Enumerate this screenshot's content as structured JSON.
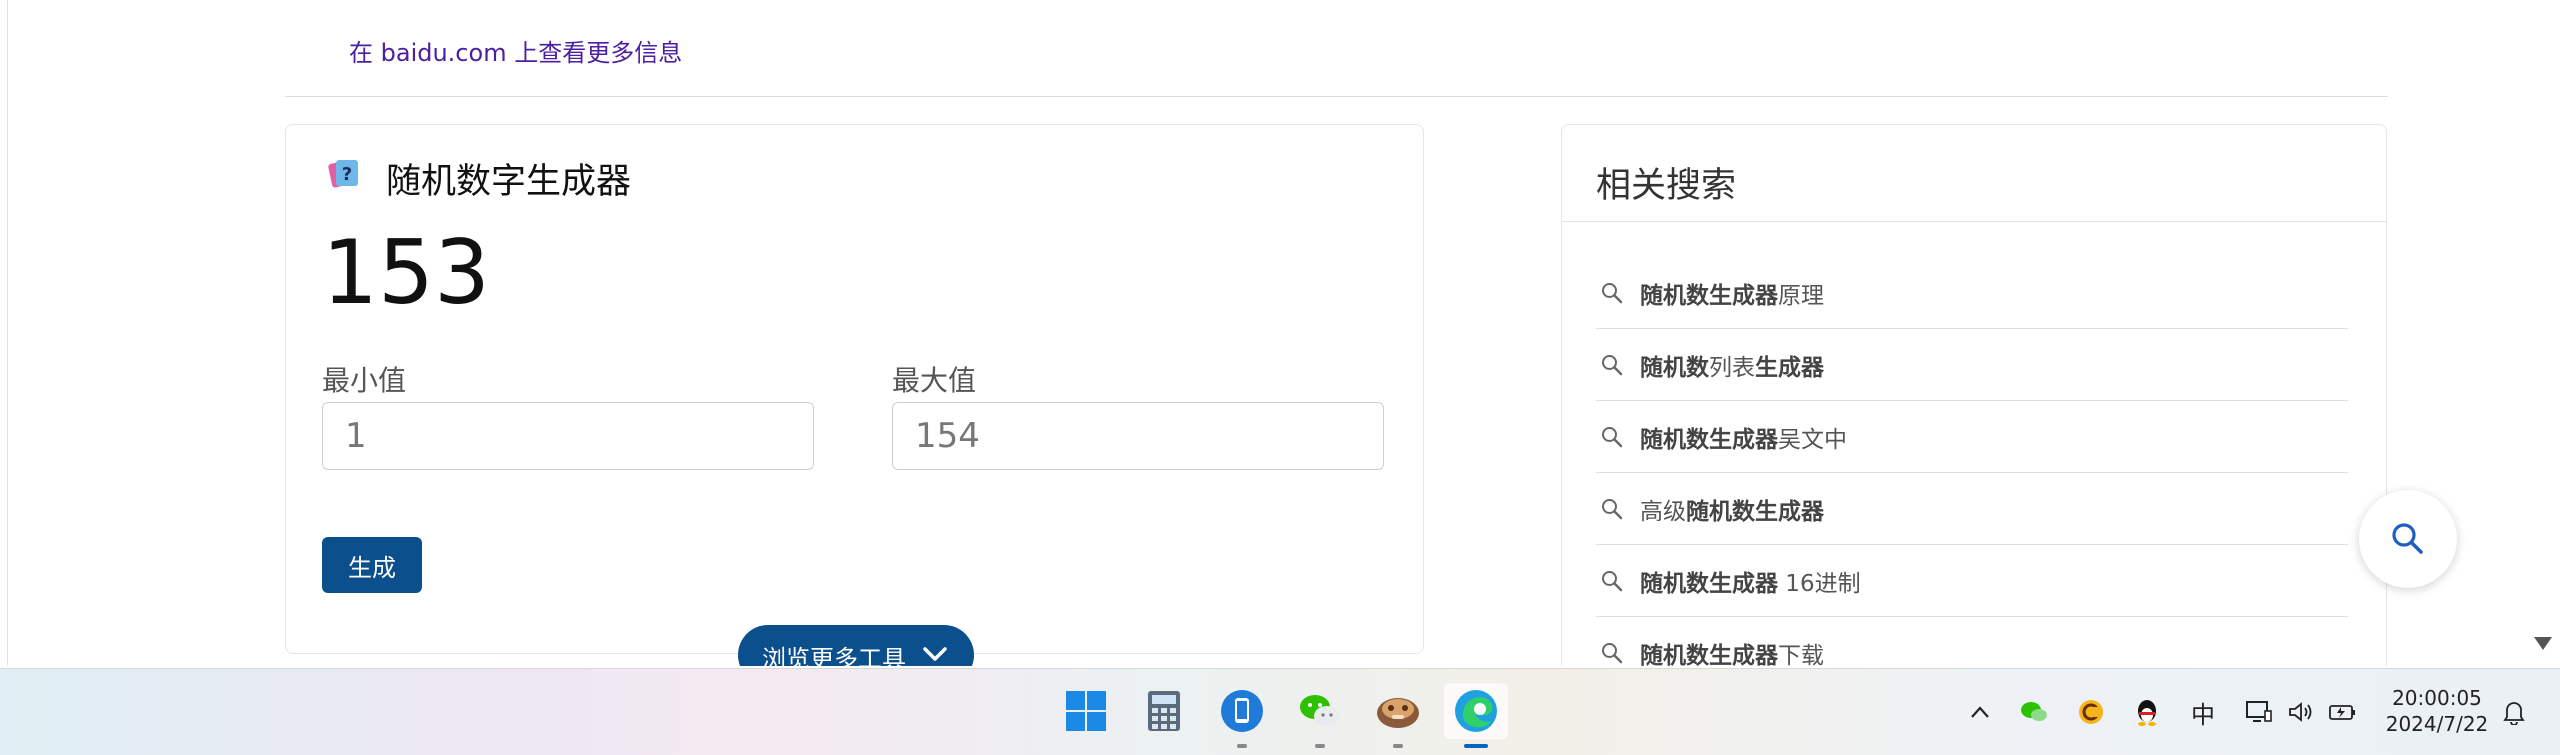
{
  "link": {
    "bing_link": "在 baidu.com 上查看更多信息"
  },
  "generator": {
    "title": "随机数字生成器",
    "result": "153",
    "min_label": "最小值",
    "min_value": "1",
    "max_label": "最大值",
    "max_value": "154",
    "generate_label": "生成",
    "more_tools_label": "浏览更多工具"
  },
  "related": {
    "title": "相关搜索",
    "items": [
      {
        "bold1": "随机数生成器",
        "normal": "原理",
        "bold2": ""
      },
      {
        "bold1": "随机数",
        "normal": "列表",
        "bold2": "生成器"
      },
      {
        "bold1": "随机数生成器",
        "normal": "吴文中",
        "bold2": ""
      },
      {
        "bold1": "",
        "normal": "高级",
        "bold2": "随机数生成器"
      },
      {
        "bold1": "随机数生成器",
        "normal": " 16进制",
        "bold2": ""
      },
      {
        "bold1": "随机数生成器",
        "normal": "下载",
        "bold2": ""
      }
    ]
  },
  "taskbar": {
    "apps": [
      "start-icon",
      "calculator-icon",
      "phone-link-icon",
      "wechat-icon",
      "game-icon",
      "edge-icon"
    ],
    "tray": {
      "ime": "中"
    },
    "clock": {
      "time": "20:00:05",
      "date": "2024/7/22"
    }
  },
  "colors": {
    "accent": "#0b4f8c",
    "link": "#4b1fa0",
    "edge_indicator": "#0067c0"
  }
}
